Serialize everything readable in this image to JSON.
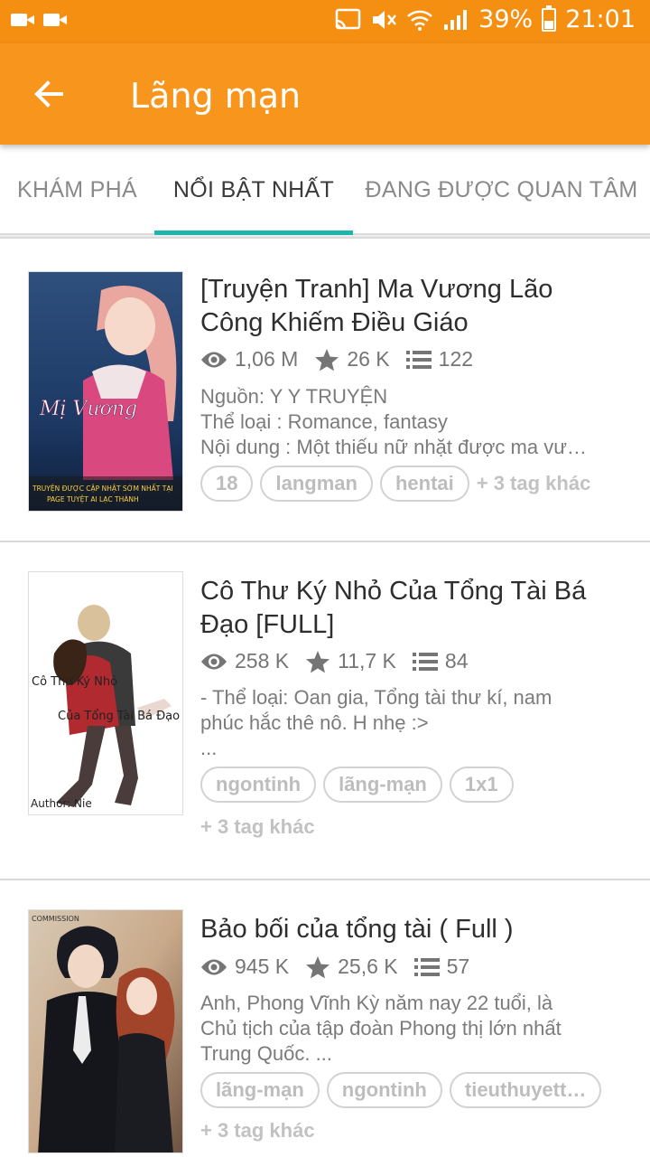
{
  "status_bar": {
    "battery": "39%",
    "time": "21:01",
    "icons": [
      "video-camera-icon",
      "video-camera-icon",
      "cast-icon",
      "mute-icon",
      "wifi-icon",
      "signal-icon",
      "battery-icon"
    ]
  },
  "app_bar": {
    "title": "Lãng mạn",
    "back_icon": "arrow-back-icon",
    "color": "#f8951d"
  },
  "tabs": [
    {
      "label": "KHÁM PHÁ",
      "active": false
    },
    {
      "label": "NỔI BẬT NHẤT",
      "active": true
    },
    {
      "label": "ĐANG ĐƯỢC QUAN TÂM",
      "active": false
    }
  ],
  "accent_color": "#1fb5ad",
  "stories": [
    {
      "title_lines": [
        "[Truyện Tranh] Ma Vương Lão",
        "Công Khiếm Điều Giáo"
      ],
      "views": "1,06 M",
      "rating": "26 K",
      "chapters": "122",
      "desc_lines": [
        "Nguồn: Y Y TRUYỆN",
        "Thể loại : Romance, fantasy",
        "Nội dung : Một thiếu nữ nhặt được ma vư…"
      ],
      "tags": [
        "18",
        "langman",
        "hentai"
      ],
      "more_tags": "+ 3 tag khác",
      "cover_text": [
        "Mị Vương",
        "TRUYỆN ĐƯỢC CẬP NHẬT SỚM NHẤT TẠI",
        "PAGE TUYỆT AI LẠC THÀNH"
      ]
    },
    {
      "title_lines": [
        "Cô Thư Ký Nhỏ Của Tổng Tài Bá",
        "Đạo [FULL]"
      ],
      "views": "258 K",
      "rating": "11,7 K",
      "chapters": "84",
      "desc_lines": [
        "- Thể loại: Oan gia, Tổng tài thư kí, nam",
        "phúc hắc thê nô. H nhẹ :>",
        "..."
      ],
      "tags": [
        "ngontinh",
        "lãng-mạn",
        "1x1"
      ],
      "more_tags": "+ 3 tag khác",
      "cover_text": [
        "Cô Thư Ký Nhỏ",
        "Của Tổng Tài Bá Đạo",
        "Author: Nie"
      ]
    },
    {
      "title_lines": [
        "Bảo bối của tổng tài ( Full )"
      ],
      "views": "945 K",
      "rating": "25,6 K",
      "chapters": "57",
      "desc_lines": [
        "Anh, Phong Vĩnh Kỳ năm nay 22 tuổi, là",
        "Chủ tịch của tập đoàn Phong thị lớn nhất",
        "Trung Quốc. ..."
      ],
      "tags": [
        "lãng-mạn",
        "ngontinh",
        "tieuthuyett…"
      ],
      "more_tags": "+ 3 tag khác",
      "cover_text": [
        "COMMISSION"
      ]
    }
  ]
}
